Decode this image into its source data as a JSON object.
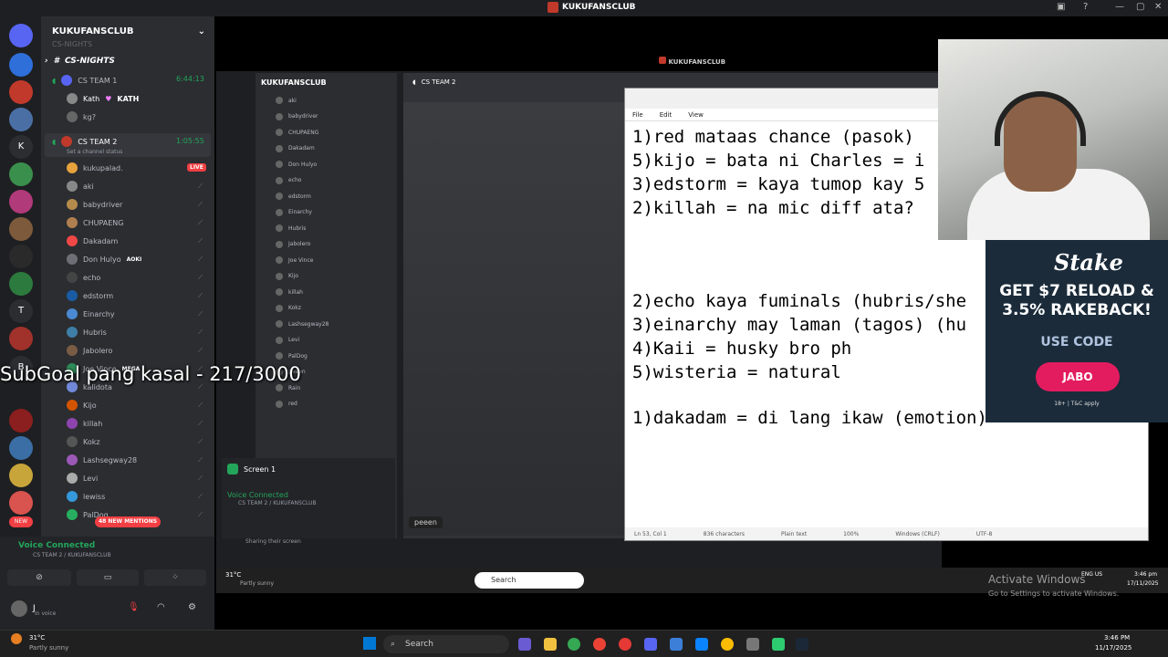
{
  "window": {
    "title": "KUKUFANSCLUB"
  },
  "server": {
    "name": "KUKUFANSCLUB",
    "channel_prev": "CS-NIGHTS",
    "channel_heading": "CS-NIGHTS"
  },
  "team1": {
    "name": "CS TEAM 1",
    "time": "6:44:13",
    "members": [
      "Kath",
      "kg?"
    ],
    "kath_tag": "KATH"
  },
  "team2": {
    "name": "CS TEAM 2",
    "time": "1:05:55",
    "status": "Set a channel status",
    "members": [
      {
        "name": "kukupalad.",
        "live": "LIVE",
        "color": "#e6a23c"
      },
      {
        "name": "aki",
        "color": "#888"
      },
      {
        "name": "babydriver",
        "color": "#b58b4c"
      },
      {
        "name": "CHUPAENG",
        "color": "#b07f50"
      },
      {
        "name": "Dakadam",
        "color": "#f04747"
      },
      {
        "name": "Don Hulyo",
        "tag": "AOKI",
        "color": "#6c6f75"
      },
      {
        "name": "echo",
        "color": "#444"
      },
      {
        "name": "edstorm",
        "color": "#1a5ca3"
      },
      {
        "name": "Einarchy",
        "color": "#4b8ad2"
      },
      {
        "name": "Hubris",
        "color": "#3f7ea6"
      },
      {
        "name": "Jabolero",
        "color": "#7a5c44"
      },
      {
        "name": "Joe Vince",
        "tag": "MEGA",
        "color": "#2e8b57"
      },
      {
        "name": "kalidota",
        "color": "#7289da"
      },
      {
        "name": "Kijo",
        "color": "#d35400"
      },
      {
        "name": "killah",
        "color": "#8e44ad"
      },
      {
        "name": "Kokz",
        "color": "#555"
      },
      {
        "name": "Lashsegway28",
        "color": "#9b59b6"
      },
      {
        "name": "Levi",
        "color": "#aaa"
      },
      {
        "name": "lewiss",
        "color": "#3498db"
      },
      {
        "name": "PalDog",
        "color": "#27ae60"
      }
    ]
  },
  "mentions": "48 NEW MENTIONS",
  "voice": {
    "status": "Voice Connected",
    "channel": "CS TEAM 2 / KUKUFANSCLUB"
  },
  "user": {
    "name": "J",
    "status": "In voice"
  },
  "weather": {
    "temp": "31°C",
    "desc": "Partly sunny"
  },
  "inner": {
    "title": "KUKUFANSCLUB",
    "channel": "CS TEAM 2",
    "server": "KUKUFANSCLUB",
    "members": [
      "aki",
      "babydriver",
      "CHUPAENG",
      "Dakadam",
      "Don Hulyo",
      "echo",
      "edstorm",
      "Einarchy",
      "Hubris",
      "Jabolero",
      "Joe Vince",
      "Kijo",
      "killah",
      "Kokz",
      "Lashsegway28",
      "Levi",
      "PalDog",
      "peeen",
      "Rain",
      "red"
    ],
    "screen": "Screen 1",
    "voice_status": "Voice Connected",
    "voice_channel": "CS TEAM 2 / KUKUFANSCLUB",
    "user_status": "Sharing their screen",
    "viewer": "peeen",
    "weather_temp": "31°C",
    "weather_desc": "Partly sunny",
    "search": "Search",
    "time": "3:46 pm",
    "date": "17/11/2025",
    "lang": "ENG US"
  },
  "notepad": {
    "menu": [
      "File",
      "Edit",
      "View"
    ],
    "lines": [
      {
        "t": "1)red mataas chance (pasok)"
      },
      {
        "t": "5)kijo = bata ni Charles = i"
      },
      {
        "t": "3)edstorm = kaya tumop kay 5"
      },
      {
        "t": "2)killah = na mic diff ata?"
      },
      {
        "t": "2)echo kaya fuminals (hubris/she"
      },
      {
        "t": "3)einarchy may laman (tagos) (hu"
      },
      {
        "t": "4)Kaii = husky bro ph"
      },
      {
        "t": "5)wisteria = natural"
      },
      {
        "t": "1)dakadam = di lang ikaw (emotion)"
      }
    ],
    "status": [
      "Ln 53, Col 1",
      "836 characters",
      "Plain text",
      "100%",
      "Windows (CRLF)",
      "UTF-8"
    ]
  },
  "stake": {
    "brand": "Stake",
    "promo1": "GET $7 RELOAD &",
    "promo2": "3.5% RAKEBACK!",
    "code_label": "USE CODE",
    "code": "JABO",
    "tc": "18+ | T&C apply"
  },
  "overlay": {
    "subgoal": "SubGoal pang kasal - 217/3000"
  },
  "watermark": {
    "line1": "Activate Windows",
    "line2": "Go to Settings to activate Windows."
  },
  "taskbar": {
    "search": "Search",
    "time": "3:46 PM",
    "date": "11/17/2025",
    "temp": "31°C",
    "desc": "Partly sunny"
  }
}
